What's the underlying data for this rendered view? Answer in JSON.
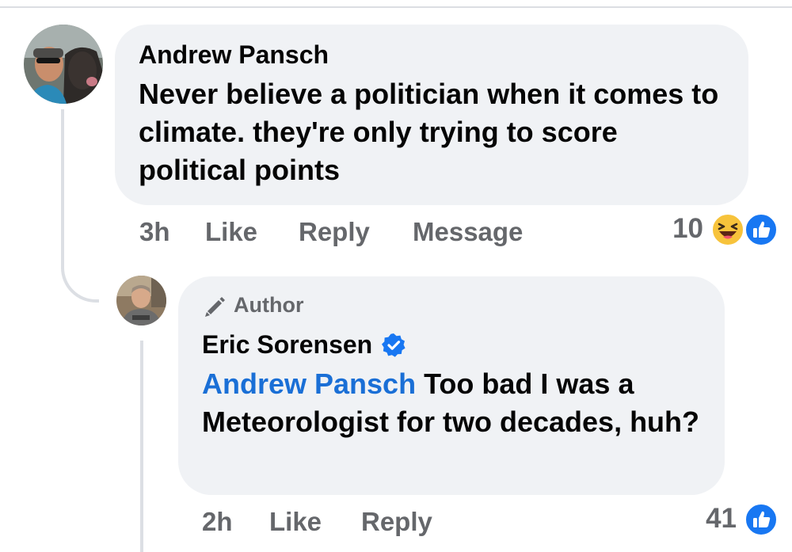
{
  "comment": {
    "author": "Andrew Pansch",
    "text": "Never believe a politician when it comes to climate. they're only trying to score political points",
    "time": "3h",
    "actions": {
      "like": "Like",
      "reply": "Reply",
      "message": "Message"
    },
    "reaction_count": "10",
    "reactions": [
      "haha",
      "like"
    ]
  },
  "reply": {
    "badge": "Author",
    "author": "Eric Sorensen",
    "verified": true,
    "mention": "Andrew Pansch",
    "text": "Too bad I was a Meteorologist for two decades, huh?",
    "time": "2h",
    "actions": {
      "like": "Like",
      "reply": "Reply"
    },
    "reaction_count": "41",
    "reactions": [
      "like"
    ]
  },
  "colors": {
    "bubble": "#f0f2f5",
    "meta_text": "#65676b",
    "mention": "#1a6fd6",
    "like_blue": "#1877f2",
    "thread_line": "#dcdfe4"
  }
}
